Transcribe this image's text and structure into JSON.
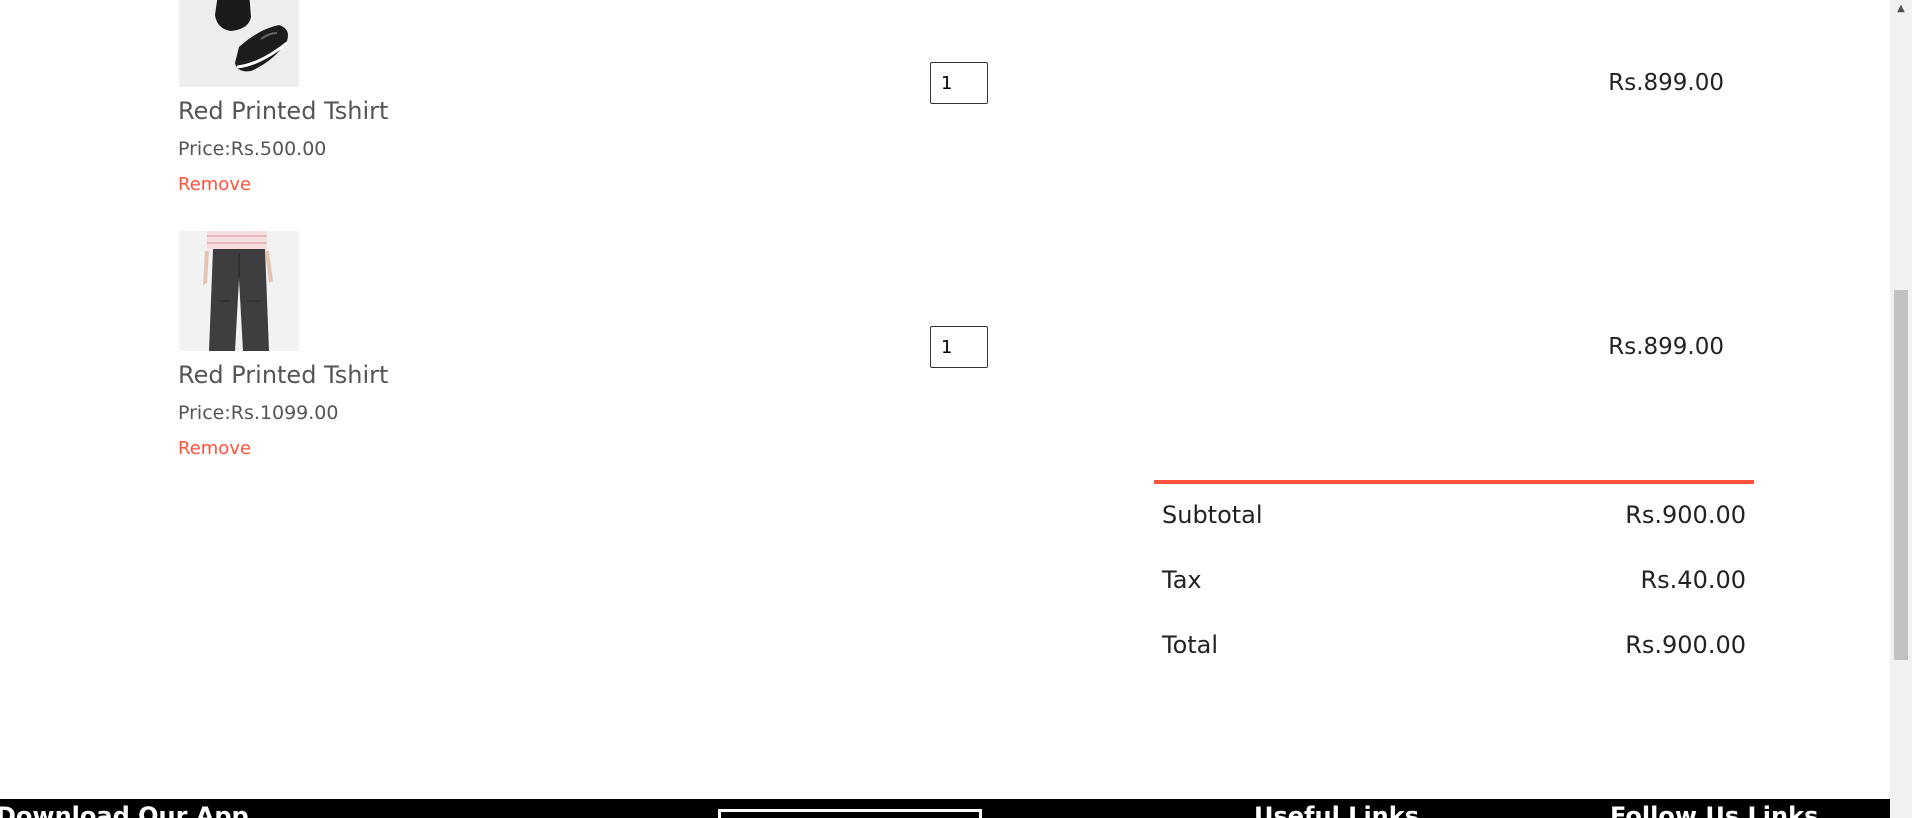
{
  "cart": {
    "items": [
      {
        "name": "Red Printed Tshirt",
        "price": "Price:Rs.500.00",
        "remove_label": "Remove",
        "quantity": "1",
        "subtotal": "Rs.899.00",
        "image_icon": "shoes-image"
      },
      {
        "name": "Red Printed Tshirt",
        "price": "Price:Rs.1099.00",
        "remove_label": "Remove",
        "quantity": "1",
        "subtotal": "Rs.899.00",
        "image_icon": "trousers-image"
      }
    ]
  },
  "totals": {
    "subtotal_label": "Subtotal",
    "subtotal_value": "Rs.900.00",
    "tax_label": "Tax",
    "tax_value": "Rs.40.00",
    "total_label": "Total",
    "total_value": "Rs.900.00"
  },
  "footer": {
    "download_heading": "Download Our App",
    "useful_links_heading": "Useful Links",
    "follow_heading": "Follow Us Links"
  },
  "colors": {
    "accent": "#ff523b",
    "text": "#555555",
    "footer_bg": "#000000"
  }
}
